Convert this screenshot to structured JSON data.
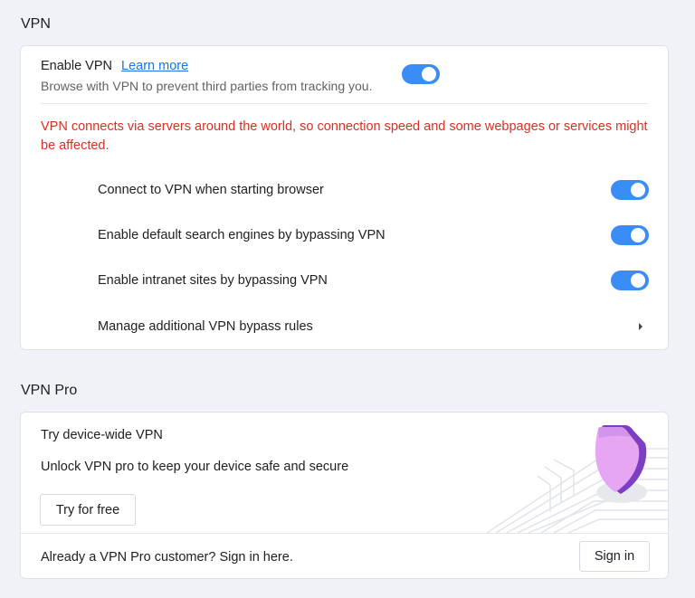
{
  "vpn_section": {
    "title": "VPN",
    "enable_label": "Enable VPN",
    "learn_more": "Learn more",
    "description": "Browse with VPN to prevent third parties from tracking you.",
    "enabled": true,
    "warning": "VPN connects via servers around the world, so connection speed and some webpages or services might be affected.",
    "options": [
      {
        "label": "Connect to VPN when starting browser",
        "enabled": true
      },
      {
        "label": "Enable default search engines by bypassing VPN",
        "enabled": true
      },
      {
        "label": "Enable intranet sites by bypassing VPN",
        "enabled": true
      }
    ],
    "manage_rules": "Manage additional VPN bypass rules"
  },
  "vpn_pro_section": {
    "title": "VPN Pro",
    "promo_title": "Try device-wide VPN",
    "promo_desc": "Unlock VPN pro to keep your device safe and secure",
    "try_button": "Try for free",
    "signin_prompt": "Already a VPN Pro customer? Sign in here.",
    "signin_button": "Sign in"
  },
  "colors": {
    "accent": "#3b8df6",
    "warning": "#d93025",
    "link": "#1a73e8",
    "shield": "#b06ee6"
  },
  "icons": {
    "chevron": "chevron-right-icon",
    "illustration": "shield-icon"
  }
}
